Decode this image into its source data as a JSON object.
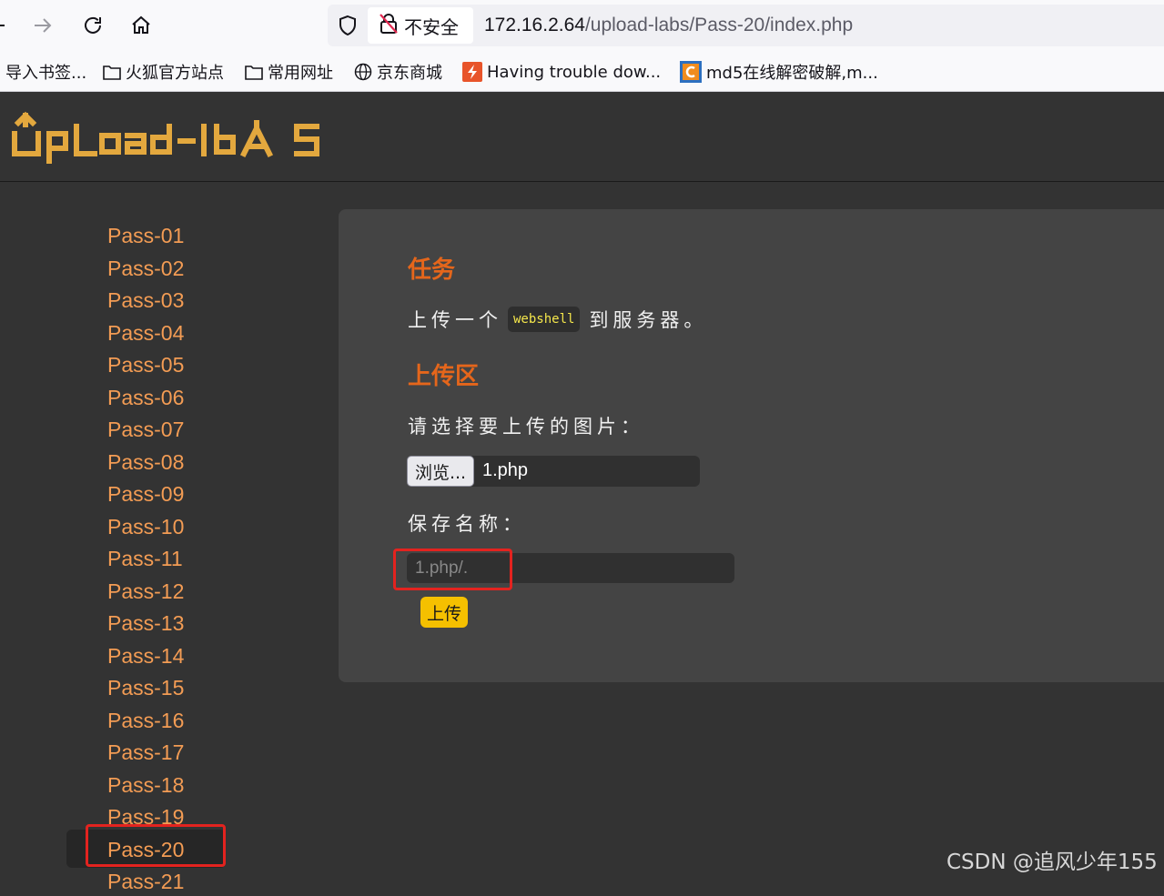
{
  "browser": {
    "nav_icons": [
      "back-arrow-icon",
      "forward-arrow-icon",
      "reload-icon",
      "home-icon"
    ],
    "security_label": "不安全",
    "url_host": "172.16.2.64",
    "url_path": "/upload-labs/Pass-20/index.php"
  },
  "bookmarks": [
    {
      "label": "导入书签...",
      "icon": "none"
    },
    {
      "label": "火狐官方站点",
      "icon": "folder-icon"
    },
    {
      "label": "常用网址",
      "icon": "folder-icon"
    },
    {
      "label": "京东商城",
      "icon": "globe-icon"
    },
    {
      "label": "Having trouble dow...",
      "icon": "flash-icon"
    },
    {
      "label": "md5在线解密破解,m...",
      "icon": "c-logo-icon"
    }
  ],
  "header": {
    "logo_text": "Upload-labs"
  },
  "sidebar": {
    "items": [
      "Pass-01",
      "Pass-02",
      "Pass-03",
      "Pass-04",
      "Pass-05",
      "Pass-06",
      "Pass-07",
      "Pass-08",
      "Pass-09",
      "Pass-10",
      "Pass-11",
      "Pass-12",
      "Pass-13",
      "Pass-14",
      "Pass-15",
      "Pass-16",
      "Pass-17",
      "Pass-18",
      "Pass-19",
      "Pass-20",
      "Pass-21"
    ],
    "active": "Pass-20"
  },
  "main": {
    "task_title": "任务",
    "task_prefix": "上传一个",
    "task_code": "webshell",
    "task_suffix": "到服务器。",
    "upload_title": "上传区",
    "choose_label": "请选择要上传的图片：",
    "browse_label": "浏览...",
    "file_name": "1.php",
    "save_label": "保存名称：",
    "save_value": "1.php/.",
    "upload_button": "上传"
  },
  "colors": {
    "accent_orange": "#e5661b",
    "link_orange": "#f39c54",
    "button_yellow": "#f5c000",
    "highlight_red": "#e3231f"
  },
  "watermark": "CSDN @追风少年155"
}
